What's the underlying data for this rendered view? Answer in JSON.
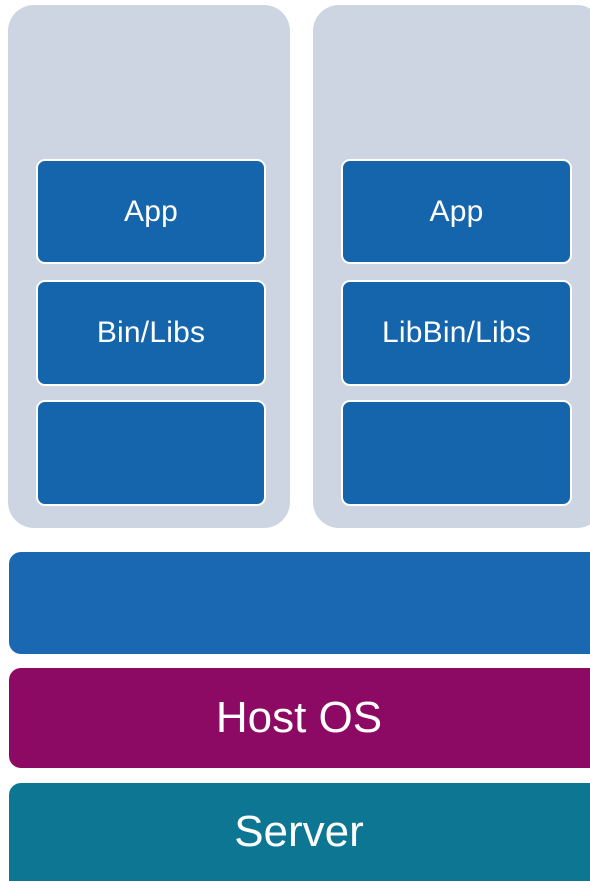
{
  "containers": [
    {
      "layers": [
        {
          "label": "App"
        },
        {
          "label": "Bin/Libs"
        },
        {
          "label": ""
        }
      ]
    },
    {
      "layers": [
        {
          "label": "App"
        },
        {
          "label": "LibBin/Libs"
        },
        {
          "label": ""
        }
      ]
    }
  ],
  "stack": {
    "engine_label": "",
    "host_os_label": "Host OS",
    "server_label": "Server"
  },
  "colors": {
    "container_bg": "#cdd4e2",
    "layer_blue": "#1565ad",
    "engine_blue": "#1a67b2",
    "host_os_purple": "#8c0a63",
    "server_teal": "#0c7693"
  }
}
